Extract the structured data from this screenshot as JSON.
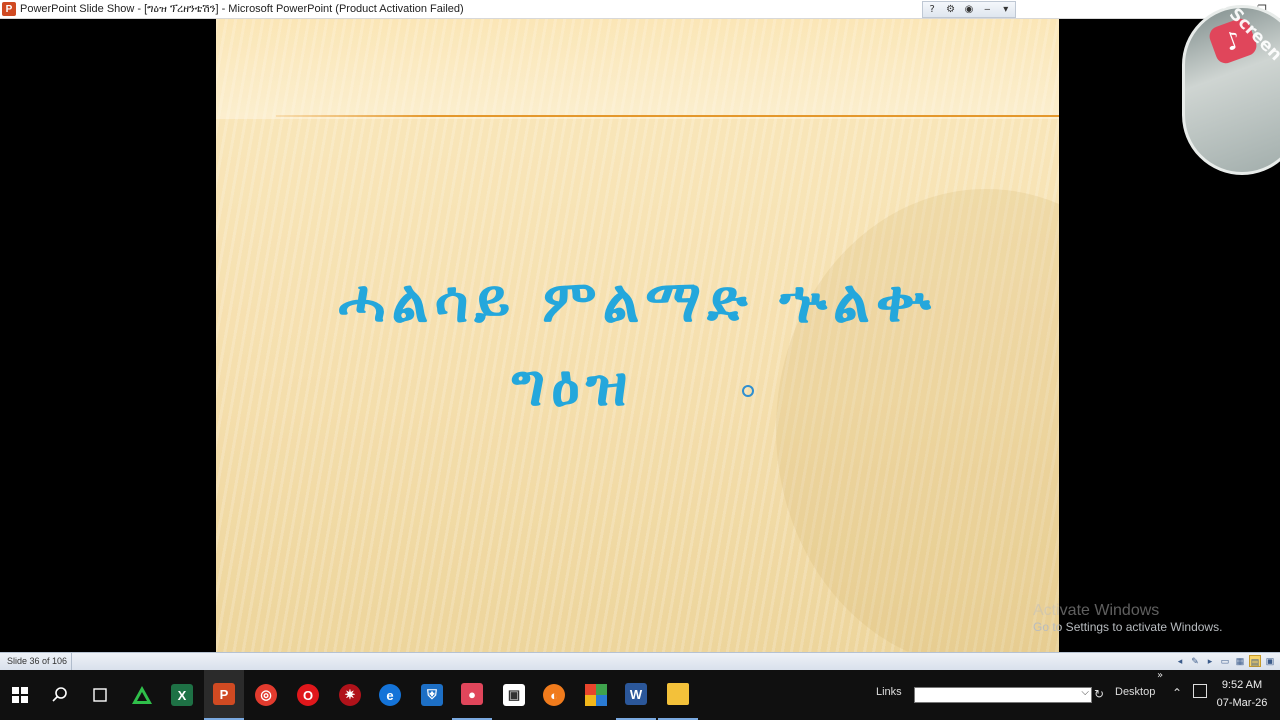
{
  "window": {
    "title": "PowerPoint Slide Show - [ግዕዝ ፕረዘንቴሽን] - Microsoft PowerPoint (Product Activation Failed)",
    "app_icon_letter": "P"
  },
  "slide": {
    "title_line1": "ሓልሳይ ምልማድ ኍልቍ",
    "title_line2": "ግዕዝ"
  },
  "watermark": {
    "recorder_text": "iTop Screen Recorder"
  },
  "activation": {
    "line1": "Activate Windows",
    "line2": "Go to Settings to activate Windows."
  },
  "statusbar": {
    "slide_count": "Slide 36 of 106"
  },
  "taskbar": {
    "links_label": "Links",
    "address_value": "",
    "desktop_label": "Desktop",
    "chevron": "»",
    "time": "9:52 AM",
    "date": "07-Mar-26"
  }
}
